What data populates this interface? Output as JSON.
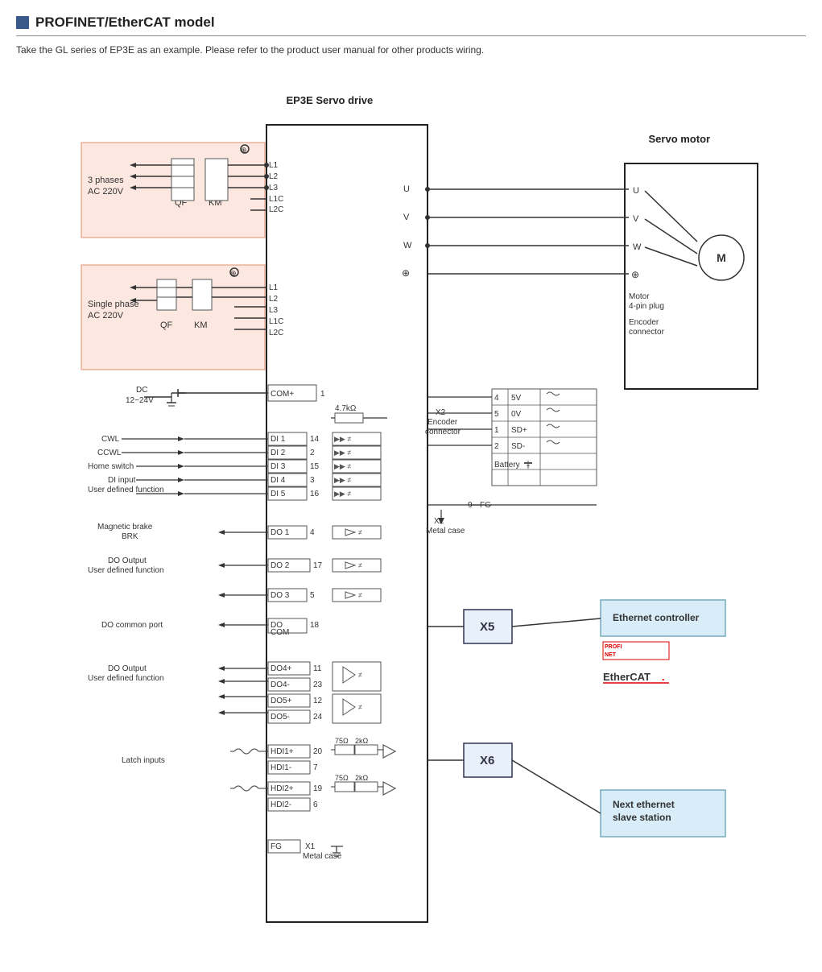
{
  "header": {
    "title": "PROFINET/EtherCAT model",
    "subtitle": "Take the GL series of EP3E as an example. Please refer to the product user manual for other products wiring."
  },
  "drive_label": "EP3E Servo drive",
  "servo_motor_label": "Servo motor",
  "power_3ph": {
    "label": "3 phases\nAC 220V",
    "qf": "QF",
    "km": "KM",
    "lines": [
      "L1",
      "L2",
      "L3",
      "L1C",
      "L2C"
    ]
  },
  "power_1ph": {
    "label": "Single phase\nAC 220V",
    "qf": "QF",
    "km": "KM",
    "lines": [
      "L1",
      "L2",
      "L3",
      "L1C",
      "L2C"
    ]
  },
  "dc_label": "DC\n12~24V",
  "di_inputs": [
    {
      "name": "CWL",
      "terminal": "DI 1",
      "num": "14"
    },
    {
      "name": "CCWL",
      "terminal": "DI 2",
      "num": "2"
    },
    {
      "name": "Home switch",
      "terminal": "DI 3",
      "num": "15"
    },
    {
      "name": "DI input\nUser defined function",
      "terminal": "DI 4",
      "num": "3"
    },
    {
      "name": "",
      "terminal": "DI 5",
      "num": "16"
    }
  ],
  "do_outputs": [
    {
      "name": "Magnetic brake\nBRK",
      "terminal": "DO 1",
      "num": "4"
    },
    {
      "name": "DO Output\nUser defined function",
      "terminal": "DO 2",
      "num": "17"
    },
    {
      "name": "",
      "terminal": "DO 3",
      "num": "5"
    },
    {
      "name": "DO common port",
      "terminal": "DO\nCOM",
      "num": "18"
    },
    {
      "name": "DO Output\nUser defined function",
      "terminal": "DO4+",
      "num": "11"
    },
    {
      "name": "",
      "terminal": "DO4-",
      "num": "23"
    },
    {
      "name": "",
      "terminal": "DO5+",
      "num": "12"
    },
    {
      "name": "",
      "terminal": "DO5-",
      "num": "24"
    }
  ],
  "latch_inputs": [
    {
      "terminal": "HDI1+",
      "num": "20"
    },
    {
      "terminal": "HDI1-",
      "num": "7"
    },
    {
      "terminal": "HDI2+",
      "num": "19"
    },
    {
      "terminal": "HDI2-",
      "num": "6"
    }
  ],
  "fg_terminal": {
    "label": "FG",
    "sub": "X1\nMetal case"
  },
  "encoder_connector": {
    "label": "X2\nEncoder\nconnector",
    "pins": [
      {
        "num": "4",
        "name": "5V"
      },
      {
        "num": "5",
        "name": "0V"
      },
      {
        "num": "1",
        "name": "SD+"
      },
      {
        "num": "2",
        "name": "SD-"
      }
    ],
    "battery": "Battery",
    "fg_pin": {
      "num": "9",
      "name": "FG"
    },
    "metal_case": "X2\nMetal case"
  },
  "motor_pins": [
    "U",
    "V",
    "W",
    "⊕"
  ],
  "motor_labels": [
    "Motor\n4-pin plug",
    "Encoder\nconnector"
  ],
  "x5_label": "X5",
  "x6_label": "X6",
  "eth_controller_label": "Ethernet controller",
  "next_slave_label": "Next ethernet\nslave station",
  "profinet_label": "PROFINET",
  "ethercat_label": "EtherCAT.",
  "com_plus": "COM+",
  "com_num": "1",
  "resistor_label": "4.7kΩ",
  "latch_resistors": [
    "75Ω",
    "2kΩ",
    "75Ω",
    "2kΩ"
  ]
}
